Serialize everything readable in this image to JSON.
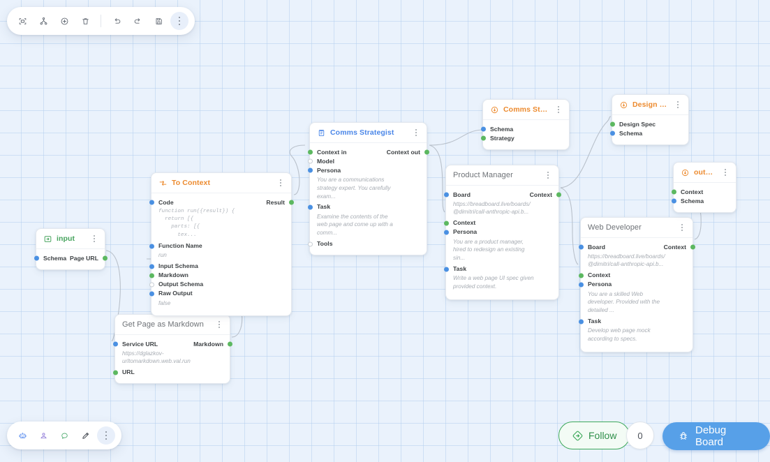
{
  "app": {
    "canvas_label": "breadboard-graph-canvas"
  },
  "top_toolbar": {
    "buttons": [
      {
        "name": "select-frame-icon",
        "label": "Select"
      },
      {
        "name": "node-tree-icon",
        "label": "Nodes"
      },
      {
        "name": "add-circle-icon",
        "label": "Add"
      },
      {
        "name": "trash-icon",
        "label": "Delete"
      },
      {
        "name": "undo-icon",
        "label": "Undo"
      },
      {
        "name": "redo-icon",
        "label": "Redo"
      },
      {
        "name": "save-icon",
        "label": "Save"
      },
      {
        "name": "more-vertical-icon",
        "label": "More"
      }
    ]
  },
  "bottom_toolbar": {
    "buttons": [
      {
        "name": "robot-icon",
        "label": "Agent"
      },
      {
        "name": "person-icon",
        "label": "User"
      },
      {
        "name": "comment-icon",
        "label": "Comment"
      },
      {
        "name": "pen-icon",
        "label": "Draw"
      },
      {
        "name": "more-vertical-icon",
        "label": "More"
      }
    ]
  },
  "footer": {
    "follow_label": "Follow",
    "event_count": "0",
    "debug_label": "Debug Board"
  },
  "colors": {
    "accent_blue": "#4a86e8",
    "accent_orange": "#ec8a2e",
    "accent_green": "#46a35d",
    "debug_button": "#57a0e8",
    "follow_border": "#3ea95b",
    "port_in": "#4a90e2",
    "port_out": "#5cb860",
    "canvas_bg": "#eaf2fc"
  },
  "nodes": [
    {
      "id": "input",
      "title": "input",
      "icon": "input-arrow-icon",
      "title_color": "green",
      "ports": [
        {
          "label": "Schema",
          "side": "in",
          "dot": "blue"
        },
        {
          "label": "Page URL",
          "side": "out",
          "dot": "green"
        }
      ]
    },
    {
      "id": "get-page-as-markdown",
      "title": "Get Page as Markdown",
      "title_color": "plain",
      "ports": [
        {
          "label": "Service URL",
          "side": "in",
          "dot": "blue",
          "value": "https://dglazkov-\nurltomarkdown.web.val.run"
        },
        {
          "label": "Markdown",
          "side": "out",
          "dot": "green"
        },
        {
          "label": "URL",
          "side": "in",
          "dot": "green"
        }
      ]
    },
    {
      "id": "to-context",
      "title": "To Context",
      "icon": "transform-icon",
      "title_color": "orange",
      "ports": [
        {
          "label": "Code",
          "side": "in",
          "dot": "blue",
          "code": "function run({result}) {\n  return [{\n    parts: [{\n      tex..."
        },
        {
          "label": "Result",
          "side": "out",
          "dot": "green"
        },
        {
          "label": "Function Name",
          "side": "in",
          "dot": "blue",
          "value": "run"
        },
        {
          "label": "Input Schema",
          "side": "in",
          "dot": "blue"
        },
        {
          "label": "Markdown",
          "side": "in",
          "dot": "green"
        },
        {
          "label": "Output Schema",
          "side": "in",
          "dot": "hollow"
        },
        {
          "label": "Raw Output",
          "side": "in",
          "dot": "blue",
          "value": "false"
        }
      ]
    },
    {
      "id": "comms-strategist",
      "title": "Comms Strategist",
      "icon": "clipboard-icon",
      "title_color": "blue",
      "ports": [
        {
          "label": "Context in",
          "side": "in",
          "dot": "green"
        },
        {
          "label": "Context out",
          "side": "out",
          "dot": "green"
        },
        {
          "label": "Model",
          "side": "in",
          "dot": "hollow"
        },
        {
          "label": "Persona",
          "side": "in",
          "dot": "blue",
          "value": "You are a communications\nstrategy expert. You carefully\nexam..."
        },
        {
          "label": "Task",
          "side": "in",
          "dot": "blue",
          "value": "Examine the contents of the\nweb page and come up with a\ncomm..."
        },
        {
          "label": "Tools",
          "side": "in",
          "dot": "hollow"
        }
      ]
    },
    {
      "id": "comms-strategy",
      "title": "Comms Strategy",
      "icon": "output-arrow-icon",
      "title_color": "orange",
      "ports": [
        {
          "label": "Schema",
          "side": "in",
          "dot": "blue"
        },
        {
          "label": "Strategy",
          "side": "in",
          "dot": "green"
        }
      ]
    },
    {
      "id": "product-manager",
      "title": "Product Manager",
      "title_color": "plain",
      "ports": [
        {
          "label": "Board",
          "side": "in",
          "dot": "blue",
          "value": "https://breadboard.live/boards/\n@dimitri/call-anthropic-api.b..."
        },
        {
          "label": "Context",
          "side": "out",
          "dot": "green"
        },
        {
          "label": "Context",
          "side": "in",
          "dot": "green"
        },
        {
          "label": "Persona",
          "side": "in",
          "dot": "blue",
          "value": "You are a product manager,\nhired to redesign an existing\nsin..."
        },
        {
          "label": "Task",
          "side": "in",
          "dot": "blue",
          "value": "Write a web page UI spec given\nprovided context."
        }
      ]
    },
    {
      "id": "design-spec",
      "title": "Design Spec",
      "icon": "output-arrow-icon",
      "title_color": "orange",
      "ports": [
        {
          "label": "Design Spec",
          "side": "in",
          "dot": "green"
        },
        {
          "label": "Schema",
          "side": "in",
          "dot": "blue"
        }
      ]
    },
    {
      "id": "web-developer",
      "title": "Web Developer",
      "title_color": "plain",
      "ports": [
        {
          "label": "Board",
          "side": "in",
          "dot": "blue",
          "value": "https://breadboard.live/boards/\n@dimitri/call-anthropic-api.b..."
        },
        {
          "label": "Context",
          "side": "out",
          "dot": "green"
        },
        {
          "label": "Context",
          "side": "in",
          "dot": "green"
        },
        {
          "label": "Persona",
          "side": "in",
          "dot": "blue",
          "value": "You are a skilled Web\ndeveloper. Provided with the\ndetailed ..."
        },
        {
          "label": "Task",
          "side": "in",
          "dot": "blue",
          "value": "Develop web page mock\naccording to specs."
        }
      ]
    },
    {
      "id": "output",
      "title": "output",
      "icon": "output-arrow-icon",
      "title_color": "orange",
      "ports": [
        {
          "label": "Context",
          "side": "in",
          "dot": "green"
        },
        {
          "label": "Schema",
          "side": "in",
          "dot": "blue"
        }
      ]
    }
  ]
}
